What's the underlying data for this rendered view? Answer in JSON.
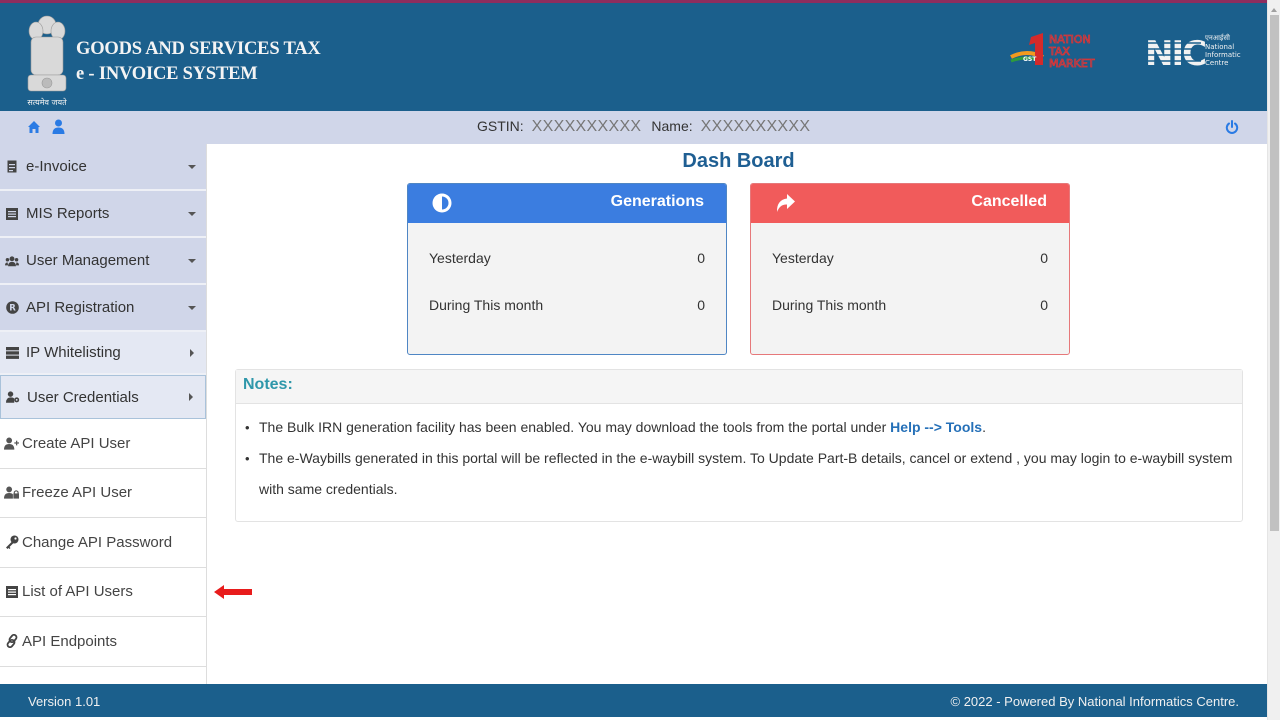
{
  "header": {
    "line1": "GOODS AND SERVICES TAX",
    "line2": "e - INVOICE SYSTEM",
    "emblem_motto": "सत्यमेव जयते",
    "logo_gst": {
      "l1": "NATION",
      "l2": "TAX",
      "l3": "MARKET",
      "tag": "GST"
    },
    "logo_nic": {
      "mark": "NIC",
      "hindi": "एनआईसी",
      "l1": "National",
      "l2": "Informatics",
      "l3": "Centre"
    }
  },
  "infobar": {
    "gstin_label": "GSTIN:",
    "gstin_value": "XXXXXXXXXX",
    "name_label": "Name:",
    "name_value": "XXXXXXXXXX"
  },
  "sidebar": {
    "items": [
      {
        "label": "e-Invoice",
        "icon": "file-icon",
        "caret": "down"
      },
      {
        "label": "MIS Reports",
        "icon": "list-icon",
        "caret": "down"
      },
      {
        "label": "User Management",
        "icon": "users-icon",
        "caret": "down"
      },
      {
        "label": "API Registration",
        "icon": "registered-icon",
        "caret": "down"
      },
      {
        "label": "IP Whitelisting",
        "icon": "server-icon",
        "caret": "right"
      },
      {
        "label": "User Credentials",
        "icon": "user-cog-icon",
        "caret": "right"
      }
    ],
    "subitems": [
      {
        "label": "Create API User",
        "icon": "user-plus-icon"
      },
      {
        "label": "Freeze API User",
        "icon": "user-lock-icon"
      },
      {
        "label": "Change API Password",
        "icon": "key-icon"
      },
      {
        "label": "List of API Users",
        "icon": "list-icon"
      },
      {
        "label": "API Endpoints",
        "icon": "link-icon"
      }
    ]
  },
  "main": {
    "title": "Dash Board",
    "cards": [
      {
        "title": "Generations",
        "color": "#3b7de0",
        "rows": [
          {
            "label": "Yesterday",
            "value": "0"
          },
          {
            "label": "During This month",
            "value": "0"
          }
        ]
      },
      {
        "title": "Cancelled",
        "color": "#f15b5b",
        "rows": [
          {
            "label": "Yesterday",
            "value": "0"
          },
          {
            "label": "During This month",
            "value": "0"
          }
        ]
      }
    ],
    "notes": {
      "title": "Notes:",
      "note1_text": "The Bulk IRN generation facility has been enabled. You may download the tools from the portal under ",
      "note1_link": "Help --> Tools",
      "note1_end": ".",
      "note2_text": "The e-Waybills generated in this portal will be reflected in the e-waybill system. To Update Part-B details, cancel or extend , you may login to e-waybill system with same credentials."
    }
  },
  "footer": {
    "version": "Version 1.01",
    "copyright": "© 2022 - Powered By National Informatics Centre."
  },
  "colors": {
    "header_bg": "#1b5f8c",
    "infobar_bg": "#d0d6e9",
    "accent_blue": "#3b7de0",
    "accent_red": "#f15b5b",
    "title_blue": "#1f5f93"
  }
}
